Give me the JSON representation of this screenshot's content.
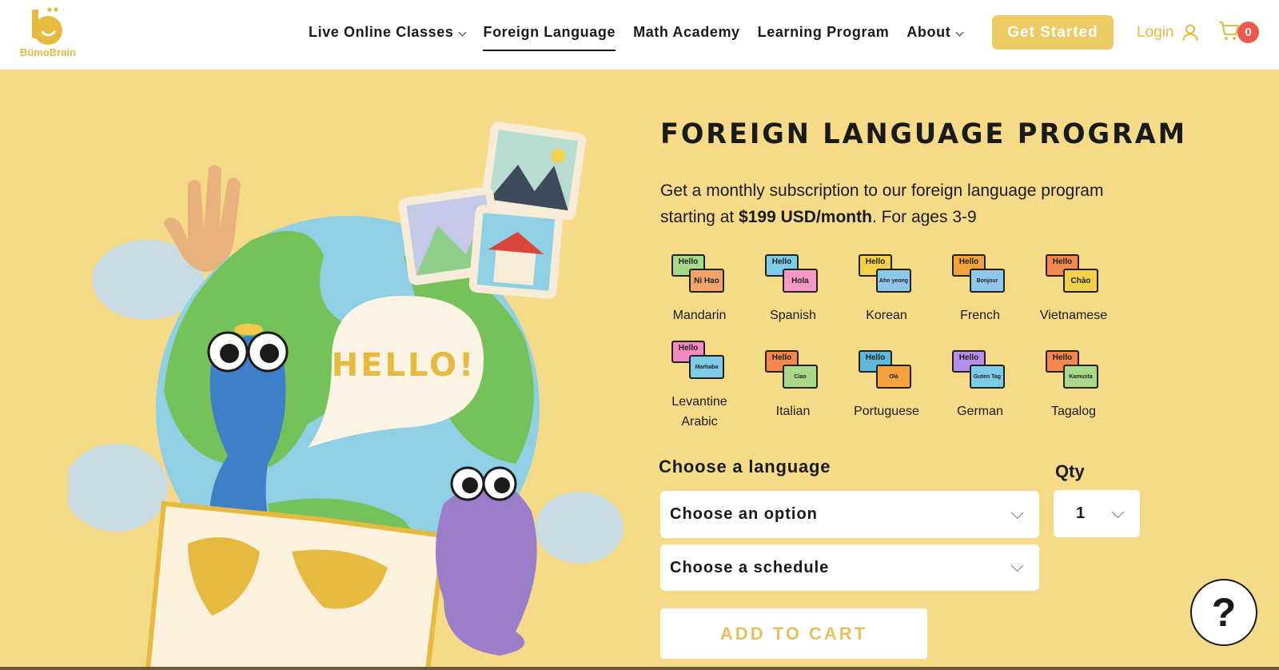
{
  "logo": {
    "text": "BümoBrain"
  },
  "nav": {
    "items": [
      {
        "label": "Live Online Classes",
        "has_dropdown": true,
        "active": false
      },
      {
        "label": "Foreign Language",
        "has_dropdown": false,
        "active": true
      },
      {
        "label": "Math Academy",
        "has_dropdown": false,
        "active": false
      },
      {
        "label": "Learning Program",
        "has_dropdown": false,
        "active": false
      },
      {
        "label": "About",
        "has_dropdown": true,
        "active": false
      }
    ],
    "get_started": "Get Started",
    "login": "Login",
    "cart_count": "0"
  },
  "illustration": {
    "speech_text": "HELLO!"
  },
  "hero": {
    "title": "FOREIGN LANGUAGE PROGRAM",
    "desc_before": "Get a monthly subscription to our foreign language program starting at ",
    "desc_price": "$199 USD/month",
    "desc_after": ". For ages 3-9"
  },
  "languages": [
    {
      "name": "Mandarin",
      "hello": "Hello",
      "greeting": "Ni Hao",
      "c1": "#a8d98b",
      "c2": "#f2a56b"
    },
    {
      "name": "Spanish",
      "hello": "Hello",
      "greeting": "Hola",
      "c1": "#7ecbe8",
      "c2": "#f29ac4"
    },
    {
      "name": "Korean",
      "hello": "Hello",
      "greeting": "Ahn yeong",
      "c1": "#f4d04f",
      "c2": "#8ec7ea"
    },
    {
      "name": "French",
      "hello": "Hello",
      "greeting": "Bonjour",
      "c1": "#f4a23c",
      "c2": "#8ec7ea"
    },
    {
      "name": "Vietnamese",
      "hello": "Hello",
      "greeting": "Chào",
      "c1": "#f4874f",
      "c2": "#f4d04f"
    },
    {
      "name": "Levantine Arabic",
      "hello": "Hello",
      "greeting": "Marhaba",
      "c1": "#f28bbd",
      "c2": "#7ecbe8"
    },
    {
      "name": "Italian",
      "hello": "Hello",
      "greeting": "Ciao",
      "c1": "#f4874f",
      "c2": "#a8d98b"
    },
    {
      "name": "Portuguese",
      "hello": "Hello",
      "greeting": "Olá",
      "c1": "#5fb8d9",
      "c2": "#f4a23c"
    },
    {
      "name": "German",
      "hello": "Hello",
      "greeting": "Guten Tag",
      "c1": "#b48ee8",
      "c2": "#7ecbe8"
    },
    {
      "name": "Tagalog",
      "hello": "Hello",
      "greeting": "Kamusta",
      "c1": "#f4874f",
      "c2": "#a8d98b"
    }
  ],
  "form": {
    "choose_language_label": "Choose a language",
    "qty_label": "Qty",
    "language_select": "Choose an option",
    "schedule_select": "Choose a schedule",
    "qty_value": "1",
    "add_to_cart": "ADD TO CART"
  },
  "help": {
    "glyph": "?"
  },
  "colors": {
    "background": "#f5db88",
    "accent": "#eccb62",
    "badge": "#ef5a4f"
  }
}
